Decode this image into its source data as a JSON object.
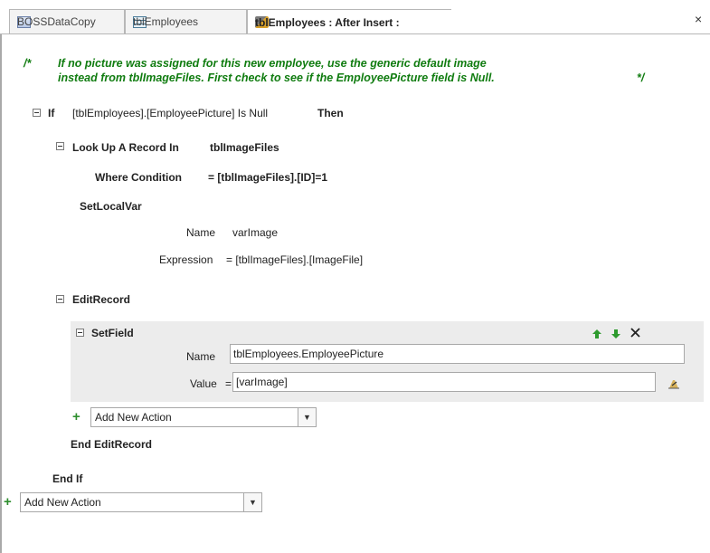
{
  "tabs": [
    {
      "label": "BOSSDataCopy",
      "icon": "database-icon"
    },
    {
      "label": "tblEmployees",
      "icon": "table-icon"
    },
    {
      "label": "tblEmployees : After Insert :",
      "icon": "macro-icon"
    }
  ],
  "close_label": "×",
  "comment": {
    "open_mark": "/*",
    "lines": [
      "If no picture was assigned for this new employee, use the generic default image",
      "instead from tblImageFiles. First check to see if the EmployeePicture field is Null."
    ],
    "close_mark": "*/"
  },
  "if_block": {
    "keyword": "If",
    "condition": "[tblEmployees].[EmployeePicture] Is Null",
    "then": "Then",
    "end": "End If"
  },
  "lookup": {
    "label": "Look Up A Record In",
    "table": "tblImageFiles",
    "where_label": "Where Condition",
    "where_value": "= [tblImageFiles].[ID]=1"
  },
  "setlocalvar": {
    "title": "SetLocalVar",
    "name_label": "Name",
    "name_value": "varImage",
    "expr_label": "Expression",
    "expr_value": "= [tblImageFiles].[ImageFile]"
  },
  "editrecord": {
    "title": "EditRecord",
    "end": "End EditRecord"
  },
  "setfield": {
    "title": "SetField",
    "name_label": "Name",
    "name_value": "tblEmployees.EmployeePicture",
    "value_label": "Value",
    "value_prefix": "=",
    "value_value": "[varImage]"
  },
  "add_action_inner": {
    "value": "Add New Action"
  },
  "add_action_outer": {
    "value": "Add New Action"
  },
  "colors": {
    "comment": "#107c10",
    "plus": "#2f8f2f",
    "arrow": "#2e9b2e"
  }
}
